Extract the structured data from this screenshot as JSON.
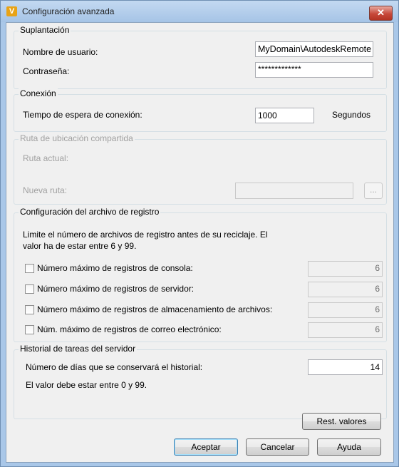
{
  "window": {
    "title": "Configuración avanzada",
    "app_icon_glyph": "V",
    "close_glyph": "✕"
  },
  "impersonation": {
    "title": "Suplantación",
    "username_label": "Nombre de usuario:",
    "username_value": "MyDomain\\AutodeskRemote",
    "password_label": "Contraseña:",
    "password_value": "*************"
  },
  "connection": {
    "title": "Conexión",
    "timeout_label": "Tiempo de espera de conexión:",
    "timeout_value": "1000",
    "unit": "Segundos"
  },
  "shared_path": {
    "title": "Ruta de ubicación compartida",
    "current_label": "Ruta actual:",
    "new_label": "Nueva ruta:",
    "new_value": "",
    "browse_label": "..."
  },
  "log_config": {
    "title": "Configuración del archivo de registro",
    "description_line1": "Limite el número de archivos de registro antes de su reciclaje. El",
    "description_line2": "valor ha de estar entre 6 y  99.",
    "items": [
      {
        "label": "Número máximo de registros de consola:",
        "value": "6",
        "checked": false
      },
      {
        "label": "Número máximo de registros de servidor:",
        "value": "6",
        "checked": false
      },
      {
        "label": "Número máximo de registros de almacenamiento de archivos:",
        "value": "6",
        "checked": false
      },
      {
        "label": "Núm. máximo de registros de correo electrónico:",
        "value": "6",
        "checked": false
      }
    ]
  },
  "history": {
    "title": "Historial de tareas del servidor",
    "days_label": "Número de días que se conservará el historial:",
    "days_value": "14",
    "note": "El valor debe estar entre 0 y 99."
  },
  "buttons": {
    "reset": "Rest. valores",
    "accept": "Aceptar",
    "cancel": "Cancelar",
    "help": "Ayuda"
  }
}
